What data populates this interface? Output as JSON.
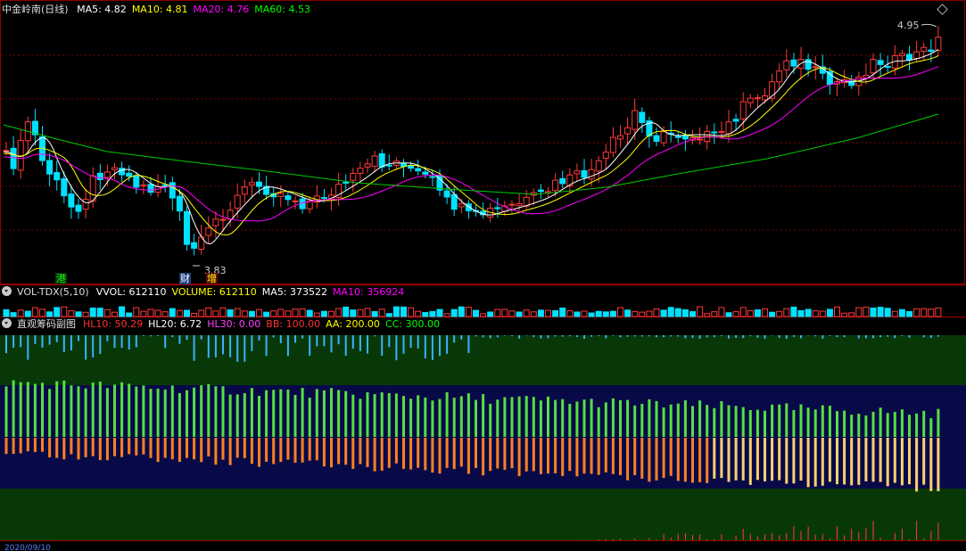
{
  "main_panel": {
    "title": "中金岭南(日线)",
    "ma_items": [
      {
        "label": "MA5: 4.82",
        "color": "#ffffff"
      },
      {
        "label": "MA10: 4.81",
        "color": "#ffff00"
      },
      {
        "label": "MA20: 4.76",
        "color": "#ff00ff"
      },
      {
        "label": "MA60: 4.53",
        "color": "#00ff00"
      }
    ],
    "high_label": "4.95",
    "low_label": "3.83",
    "markers": {
      "gang": "港",
      "cai": "财",
      "zeng": "增"
    }
  },
  "volume_panel": {
    "title": "VOL-TDX(5,10)",
    "items": [
      {
        "label": "VVOL: 612110",
        "color": "#ffffff"
      },
      {
        "label": "VOLUME: 612110",
        "color": "#ffff00"
      },
      {
        "label": "MA5: 373522",
        "color": "#ffffff"
      },
      {
        "label": "MA10: 356924",
        "color": "#ff00ff"
      }
    ]
  },
  "chip_panel": {
    "title": "直观筹码副图",
    "items": [
      {
        "label": "HL10: 50.29",
        "color": "#ff3030"
      },
      {
        "label": "HL20: 6.72",
        "color": "#ffffff"
      },
      {
        "label": "HL30: 0.00",
        "color": "#ff40ff"
      },
      {
        "label": "BB: 100.00",
        "color": "#ff3030"
      },
      {
        "label": "AA: 200.00",
        "color": "#ffff00"
      },
      {
        "label": "CC: 300.00",
        "color": "#00ff00"
      }
    ]
  },
  "date_strip": "2020/09/10",
  "colors": {
    "up": "#ff3a3a",
    "down": "#00e0ff",
    "grid": "#7a0000"
  }
}
